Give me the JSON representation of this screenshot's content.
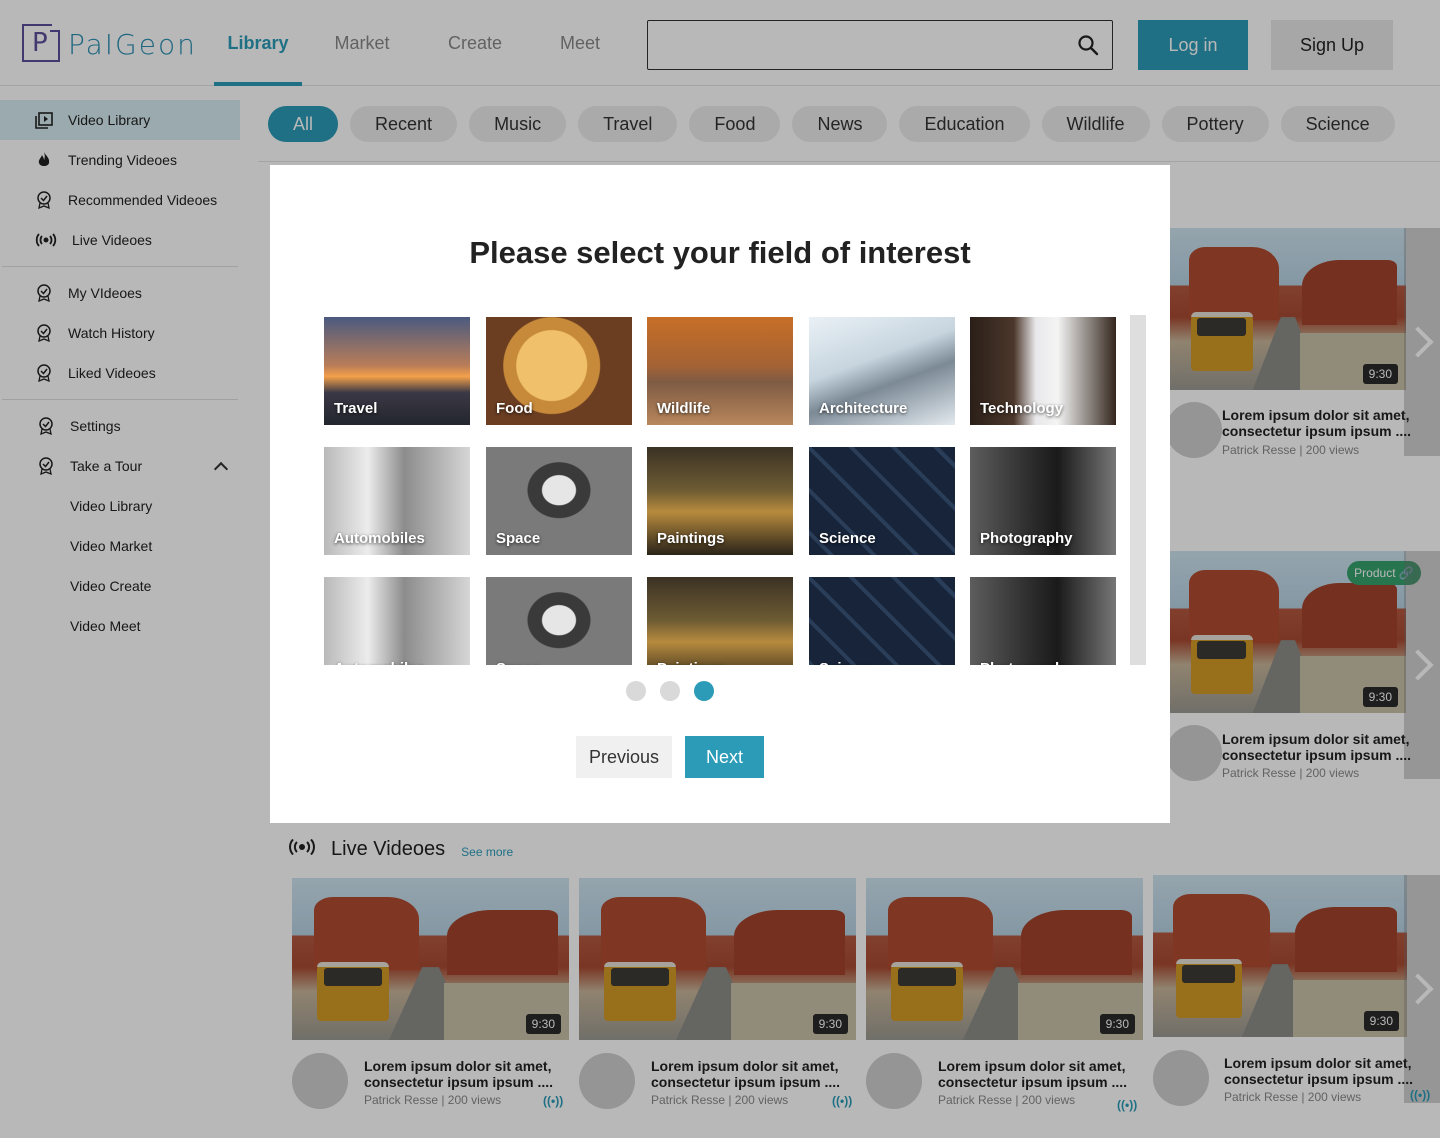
{
  "header": {
    "logo_text": "PaIGeon",
    "logo_mark": "P",
    "nav": [
      "Library",
      "Market",
      "Create",
      "Meet"
    ],
    "active_nav": "Library",
    "search_placeholder": "",
    "login_label": "Log in",
    "signup_label": "Sign Up"
  },
  "sidebar": {
    "main": [
      {
        "label": "Video Library",
        "icon": "video-library-icon"
      },
      {
        "label": "Trending Videoes",
        "icon": "flame-icon"
      },
      {
        "label": "Recommended Videoes",
        "icon": "badge-icon"
      },
      {
        "label": "Live Videoes",
        "icon": "live-icon"
      }
    ],
    "personal": [
      {
        "label": "My VIdeoes",
        "icon": "badge-icon"
      },
      {
        "label": "Watch History",
        "icon": "badge-icon"
      },
      {
        "label": "Liked Videoes",
        "icon": "badge-icon"
      }
    ],
    "settings_label": "Settings",
    "tour_label": "Take a Tour",
    "tour_items": [
      "Video Library",
      "Video Market",
      "Video Create",
      "Video Meet"
    ]
  },
  "chips": [
    "All",
    "Recent",
    "Music",
    "Travel",
    "Food",
    "News",
    "Education",
    "Wildlife",
    "Pottery",
    "Science"
  ],
  "active_chip": "All",
  "background_cards": [
    {
      "title_line1": "Lorem ipsum dolor sit amet,",
      "title_line2": "consectetur ipsum ipsum ....",
      "author": "Patrick Resse  |  200 views",
      "duration": "9:30"
    },
    {
      "title_line1": "Lorem ipsum dolor sit amet,",
      "title_line2": "consectetur ipsum ipsum ....",
      "author": "Patrick Resse  |  200 views",
      "duration": "9:30",
      "badge": "Product"
    }
  ],
  "live_section": {
    "title": "Live Videoes",
    "see_more": "See more",
    "cards": [
      {
        "title_line1": "Lorem ipsum dolor sit amet,",
        "title_line2": "consectetur ipsum ipsum ....",
        "author": "Patrick Resse  |  200 views",
        "duration": "9:30"
      },
      {
        "title_line1": "Lorem ipsum dolor sit amet,",
        "title_line2": "consectetur ipsum ipsum ....",
        "author": "Patrick Resse  |  200 views",
        "duration": "9:30"
      },
      {
        "title_line1": "Lorem ipsum dolor sit amet,",
        "title_line2": "consectetur ipsum ipsum ....",
        "author": "Patrick Resse  |  200 views",
        "duration": "9:30"
      },
      {
        "title_line1": "Lorem ipsum dolor sit amet,",
        "title_line2": "consectetur ipsum ipsum ....",
        "author": "Patrick Resse  |  200 views",
        "duration": "9:30"
      }
    ]
  },
  "modal": {
    "title": "Please select your field of interest",
    "tiles": [
      {
        "label": "Travel",
        "art": "travel"
      },
      {
        "label": "Food",
        "art": "food"
      },
      {
        "label": "Wildlife",
        "art": "wildlife"
      },
      {
        "label": "Architecture",
        "art": "arch"
      },
      {
        "label": "Technology",
        "art": "tech"
      },
      {
        "label": "Automobiles",
        "art": "auto"
      },
      {
        "label": "Space",
        "art": "space"
      },
      {
        "label": "Paintings",
        "art": "paint"
      },
      {
        "label": "Science",
        "art": "science"
      },
      {
        "label": "Photography",
        "art": "photo"
      },
      {
        "label": "Automobiles",
        "art": "auto"
      },
      {
        "label": "Space",
        "art": "space"
      },
      {
        "label": "Paintings",
        "art": "paint"
      },
      {
        "label": "Science",
        "art": "science"
      },
      {
        "label": "Photography",
        "art": "photo"
      }
    ],
    "page_count": 3,
    "active_page": 3,
    "previous_label": "Previous",
    "next_label": "Next"
  },
  "colors": {
    "accent": "#2b9bb8",
    "product_badge": "#37a36e"
  }
}
